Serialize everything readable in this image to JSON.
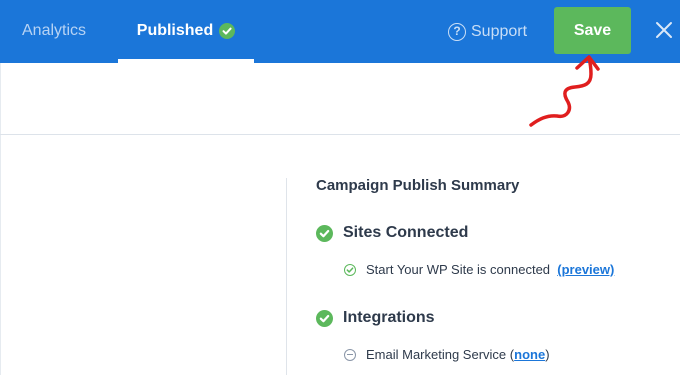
{
  "header": {
    "tabs": [
      {
        "label": "Analytics",
        "active": false
      },
      {
        "label": "Published",
        "active": true
      }
    ],
    "support_label": "Support",
    "save_label": "Save",
    "close_icon": "close-icon",
    "colors": {
      "bar": "#1b76d9",
      "save": "#5cb85c"
    }
  },
  "summary": {
    "title": "Campaign Publish Summary",
    "sections": [
      {
        "title": "Sites Connected",
        "status": "check",
        "items": [
          {
            "text": "Start Your WP Site is connected",
            "link_prefix": "",
            "link": "(preview)",
            "link_suffix": ""
          }
        ]
      },
      {
        "title": "Integrations",
        "status": "check",
        "items": [
          {
            "text": "Email Marketing Service",
            "link_prefix": "(",
            "link": "none",
            "link_suffix": ")"
          }
        ]
      }
    ]
  }
}
